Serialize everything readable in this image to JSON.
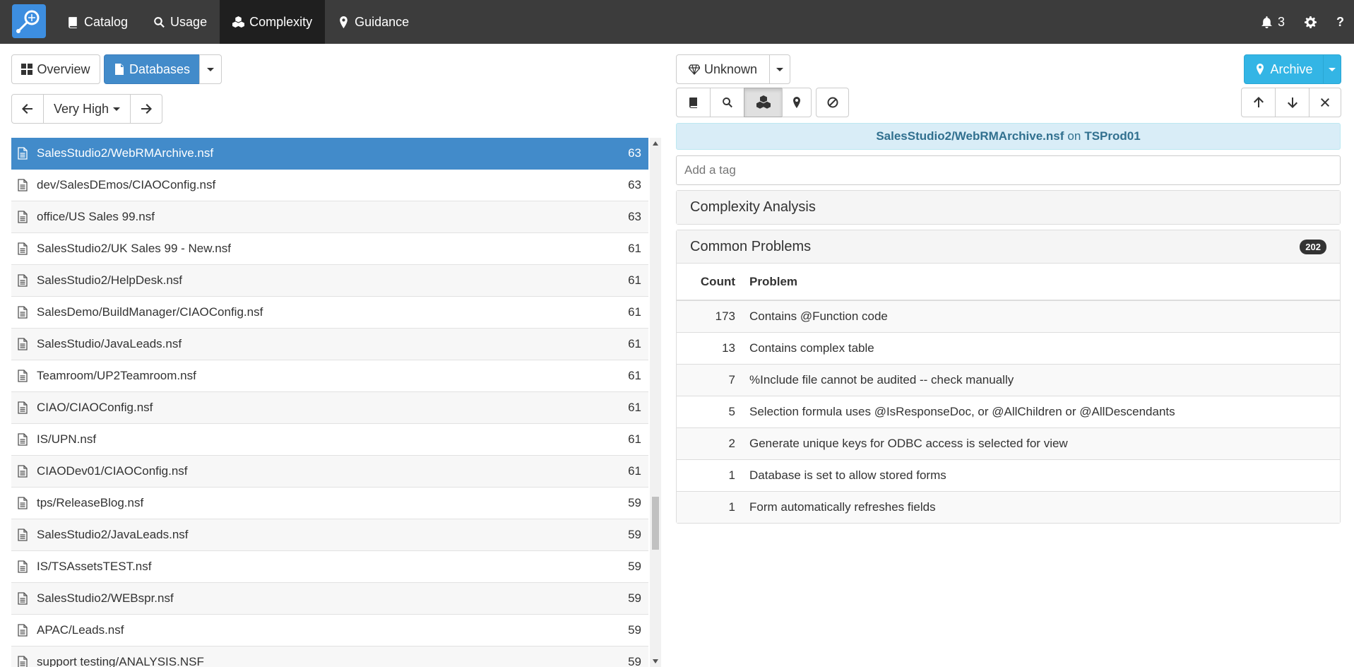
{
  "nav": {
    "items": [
      {
        "label": "Catalog",
        "icon": "book-icon"
      },
      {
        "label": "Usage",
        "icon": "search-icon"
      },
      {
        "label": "Complexity",
        "icon": "cubes-icon"
      },
      {
        "label": "Guidance",
        "icon": "map-marker-icon"
      }
    ],
    "notifications_count": "3"
  },
  "left_toolbar": {
    "overview_label": "Overview",
    "databases_label": "Databases",
    "level_label": "Very High"
  },
  "databases": [
    {
      "name": "SalesStudio2/WebRMArchive.nsf",
      "score": "63"
    },
    {
      "name": "dev/SalesDEmos/CIAOConfig.nsf",
      "score": "63"
    },
    {
      "name": "office/US Sales 99.nsf",
      "score": "63"
    },
    {
      "name": "SalesStudio2/UK Sales 99 - New.nsf",
      "score": "61"
    },
    {
      "name": "SalesStudio2/HelpDesk.nsf",
      "score": "61"
    },
    {
      "name": "SalesDemo/BuildManager/CIAOConfig.nsf",
      "score": "61"
    },
    {
      "name": "SalesStudio/JavaLeads.nsf",
      "score": "61"
    },
    {
      "name": "Teamroom/UP2Teamroom.nsf",
      "score": "61"
    },
    {
      "name": "CIAO/CIAOConfig.nsf",
      "score": "61"
    },
    {
      "name": "IS/UPN.nsf",
      "score": "61"
    },
    {
      "name": "CIAODev01/CIAOConfig.nsf",
      "score": "61"
    },
    {
      "name": "tps/ReleaseBlog.nsf",
      "score": "59"
    },
    {
      "name": "SalesStudio2/JavaLeads.nsf",
      "score": "59"
    },
    {
      "name": "IS/TSAssetsTEST.nsf",
      "score": "59"
    },
    {
      "name": "SalesStudio2/WEBspr.nsf",
      "score": "59"
    },
    {
      "name": "APAC/Leads.nsf",
      "score": "59"
    },
    {
      "name": "support testing/ANALYSIS.NSF",
      "score": "59"
    }
  ],
  "right_toolbar": {
    "classification_label": "Unknown",
    "archive_label": "Archive"
  },
  "detail": {
    "database": "SalesStudio2/WebRMArchive.nsf",
    "on_label": "on",
    "server": "TSProd01",
    "tag_placeholder": "Add a tag",
    "complexity_heading": "Complexity Analysis",
    "problems_heading": "Common Problems",
    "problems_total": "202",
    "col_count": "Count",
    "col_problem": "Problem",
    "problems": [
      {
        "count": "173",
        "problem": "Contains @Function code"
      },
      {
        "count": "13",
        "problem": "Contains complex table"
      },
      {
        "count": "7",
        "problem": "%Include file cannot be audited -- check manually"
      },
      {
        "count": "5",
        "problem": "Selection formula uses @IsResponseDoc, or @AllChildren or @AllDescendants"
      },
      {
        "count": "2",
        "problem": "Generate unique keys for ODBC access is selected for view"
      },
      {
        "count": "1",
        "problem": "Database is set to allow stored forms"
      },
      {
        "count": "1",
        "problem": "Form automatically refreshes fields"
      }
    ]
  },
  "colors": {
    "navbar": "#3c3c3c",
    "primary": "#428bca",
    "info": "#33b5e5",
    "info_bar": "#d9edf7"
  }
}
